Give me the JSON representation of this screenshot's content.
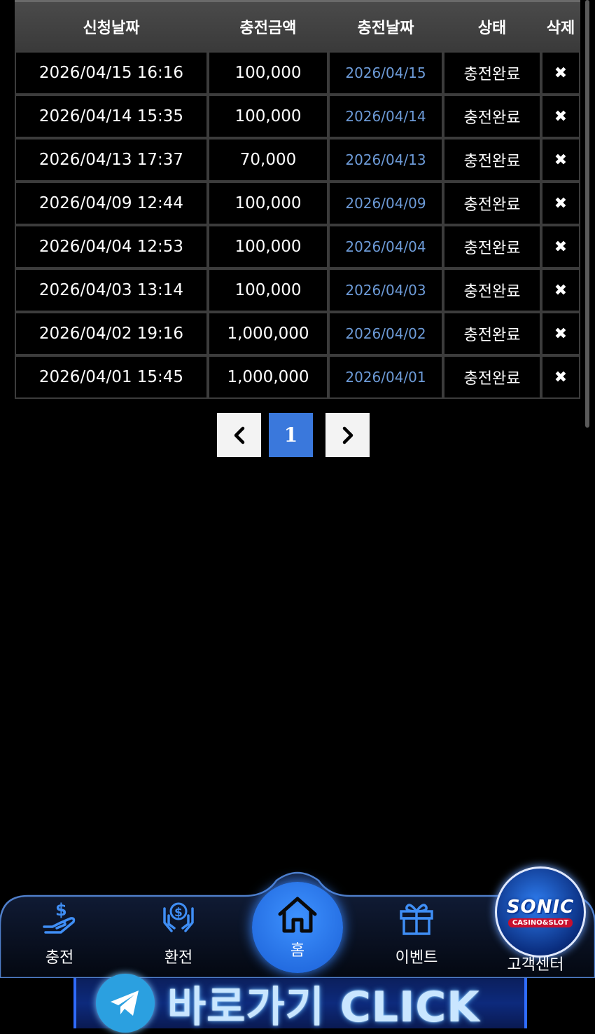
{
  "table": {
    "headers": [
      "신청날짜",
      "충전금액",
      "충전날짜",
      "상태",
      "삭제"
    ],
    "rows": [
      {
        "request_date": "2026/04/15 16:16",
        "amount": "100,000",
        "process_date": "2026/04/15",
        "status": "충전완료",
        "delete": "✖"
      },
      {
        "request_date": "2026/04/14 15:35",
        "amount": "100,000",
        "process_date": "2026/04/14",
        "status": "충전완료",
        "delete": "✖"
      },
      {
        "request_date": "2026/04/13 17:37",
        "amount": "70,000",
        "process_date": "2026/04/13",
        "status": "충전완료",
        "delete": "✖"
      },
      {
        "request_date": "2026/04/09 12:44",
        "amount": "100,000",
        "process_date": "2026/04/09",
        "status": "충전완료",
        "delete": "✖"
      },
      {
        "request_date": "2026/04/04 12:53",
        "amount": "100,000",
        "process_date": "2026/04/04",
        "status": "충전완료",
        "delete": "✖"
      },
      {
        "request_date": "2026/04/03 13:14",
        "amount": "100,000",
        "process_date": "2026/04/03",
        "status": "충전완료",
        "delete": "✖"
      },
      {
        "request_date": "2026/04/02 19:16",
        "amount": "1,000,000",
        "process_date": "2026/04/02",
        "status": "충전완료",
        "delete": "✖"
      },
      {
        "request_date": "2026/04/01 15:45",
        "amount": "1,000,000",
        "process_date": "2026/04/01",
        "status": "충전완료",
        "delete": "✖"
      }
    ]
  },
  "pagination": {
    "current_page": "1",
    "prev_icon": "chevron-left-icon",
    "next_icon": "chevron-right-icon"
  },
  "bottom_nav": {
    "deposit": {
      "label": "충전",
      "icon": "hand-dollar-icon"
    },
    "withdraw": {
      "label": "환전",
      "icon": "hands-dollar-icon"
    },
    "home": {
      "label": "홈",
      "icon": "home-icon"
    },
    "event": {
      "label": "이벤트",
      "icon": "gift-icon"
    },
    "support": {
      "label": "고객센터",
      "icon": "sonic-logo",
      "logo_title": "SONIC",
      "logo_sub": "CASINO&SLOT"
    }
  },
  "banner": {
    "text": "바로가기 CLICK",
    "icon": "telegram-icon"
  },
  "colors": {
    "accent": "#3a78dc",
    "process_date_text": "#6d9bd8",
    "header_bg": "#444444"
  }
}
